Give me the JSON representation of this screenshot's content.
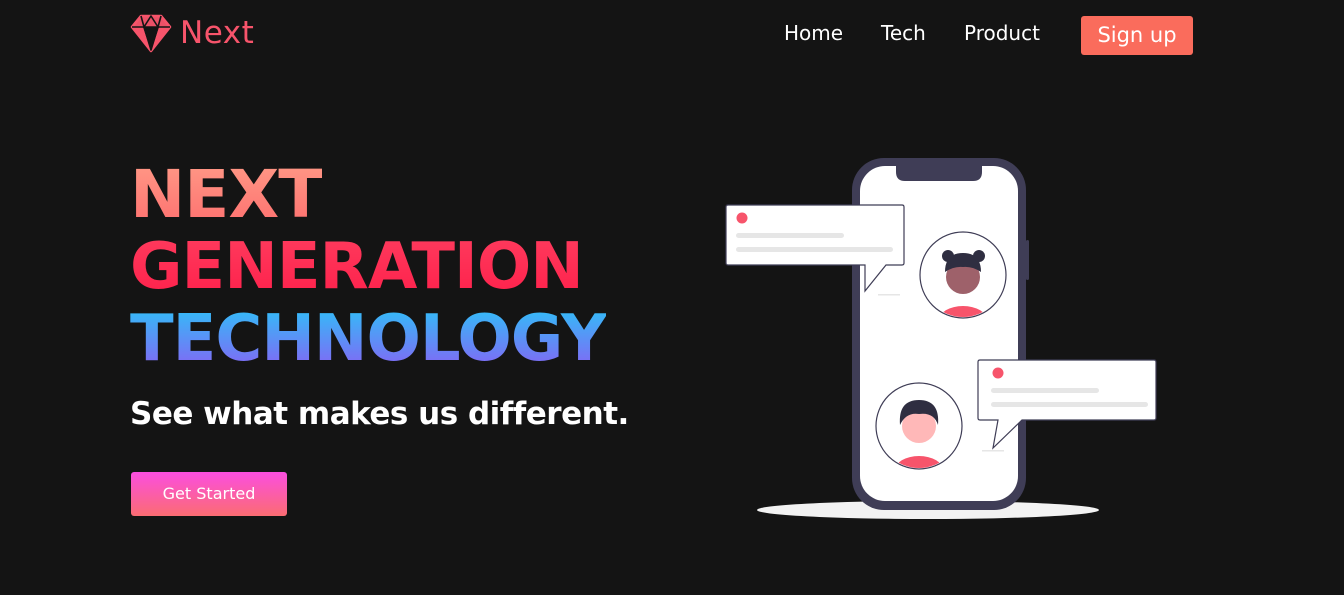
{
  "brand": {
    "name": "Next",
    "logo_icon": "diamond-icon",
    "accent_color": "#f7546b"
  },
  "nav": {
    "items": [
      {
        "label": "Home"
      },
      {
        "label": "Tech"
      },
      {
        "label": "Product"
      }
    ],
    "signup_label": "Sign up",
    "signup_color": "#fa6c5c"
  },
  "hero": {
    "line1": "NEXT",
    "line2": "GENERATION",
    "line3": "TECHNOLOGY",
    "subtitle": "See what makes us different.",
    "cta_label": "Get Started"
  },
  "illustration": {
    "subject": "smartphone-chat-illustration",
    "icons": [
      "phone-icon",
      "chat-bubble-icon",
      "avatar-icon"
    ]
  },
  "colors": {
    "background": "#141414",
    "line1_gradient": [
      "#ff9a87",
      "#fe6e6e"
    ],
    "line2_gradient": [
      "#fe3c5e",
      "#fe1f4a"
    ],
    "line3_gradient": [
      "#2bc4f8",
      "#8c5df4"
    ],
    "cta_gradient": [
      "#fb4ee0",
      "#fb6c72"
    ]
  }
}
